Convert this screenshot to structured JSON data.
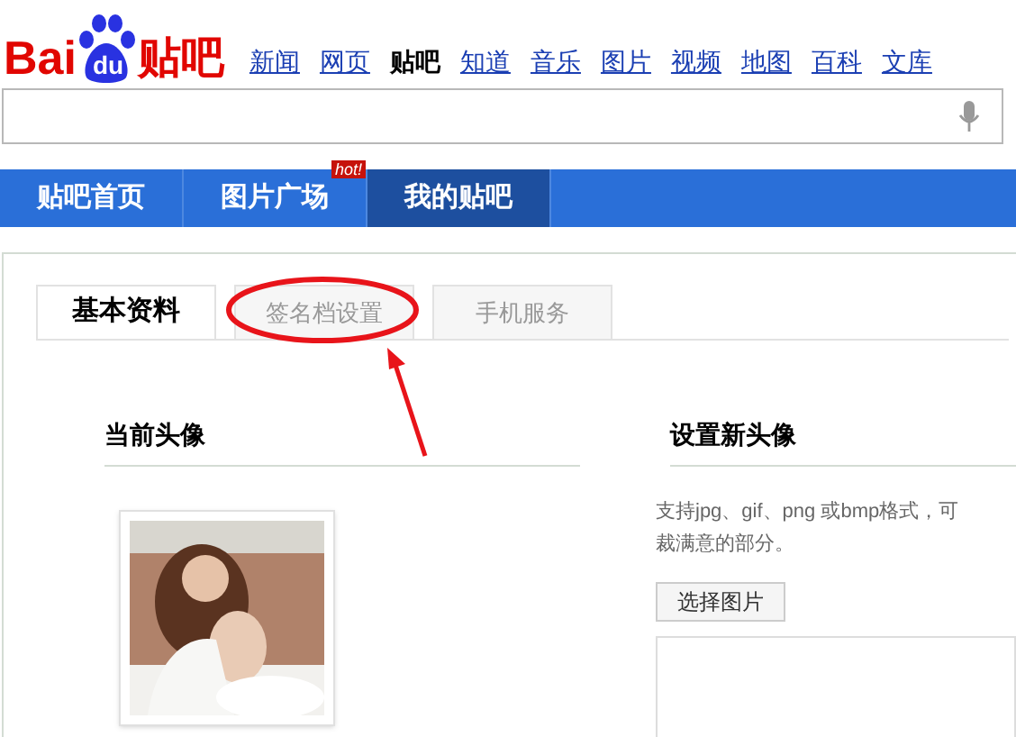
{
  "logo": {
    "parts": [
      "Bai",
      "du",
      "贴吧"
    ]
  },
  "top_nav": [
    {
      "label": "新闻",
      "selected": false
    },
    {
      "label": "网页",
      "selected": false
    },
    {
      "label": "贴吧",
      "selected": true
    },
    {
      "label": "知道",
      "selected": false
    },
    {
      "label": "音乐",
      "selected": false
    },
    {
      "label": "图片",
      "selected": false
    },
    {
      "label": "视频",
      "selected": false
    },
    {
      "label": "地图",
      "selected": false
    },
    {
      "label": "百科",
      "selected": false
    },
    {
      "label": "文库",
      "selected": false
    }
  ],
  "main_nav": [
    {
      "label": "贴吧首页",
      "selected": false
    },
    {
      "label": "图片广场",
      "selected": false,
      "badge": "hot!"
    },
    {
      "label": "我的贴吧",
      "selected": true
    }
  ],
  "tabs": [
    {
      "label": "基本资料",
      "selected": true,
      "highlighted": false
    },
    {
      "label": "签名档设置",
      "selected": false,
      "highlighted": true
    },
    {
      "label": "手机服务",
      "selected": false,
      "highlighted": false
    }
  ],
  "current_avatar": {
    "title": "当前头像"
  },
  "new_avatar": {
    "title": "设置新头像",
    "hint_lines": [
      "支持jpg、gif、png 或bmp格式，可",
      "裁满意的部分。"
    ],
    "button": "选择图片"
  }
}
